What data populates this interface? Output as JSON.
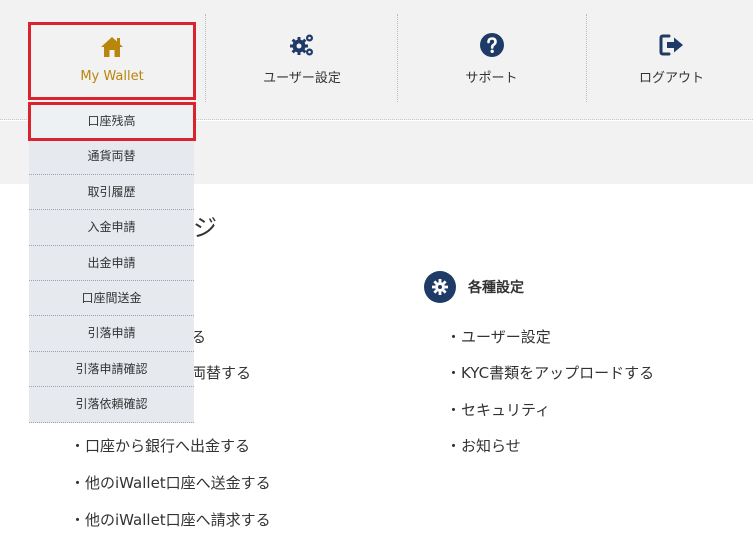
{
  "nav": {
    "items": [
      {
        "label": "My Wallet",
        "icon": "home-icon"
      },
      {
        "label": "ユーザー設定",
        "icon": "gears-icon"
      },
      {
        "label": "サポート",
        "icon": "question-circle-icon"
      },
      {
        "label": "ログアウト",
        "icon": "sign-out-icon"
      }
    ]
  },
  "dropdown": {
    "items": [
      "口座残高",
      "通貨両替",
      "取引履歴",
      "入金申請",
      "出金申請",
      "口座間送金",
      "引落申請",
      "引落申請確認",
      "引落依頼確認"
    ]
  },
  "page": {
    "title_fragment": "ジ"
  },
  "section_left": {
    "partial_links": [
      "する",
      "こ両替する"
    ],
    "links": [
      "・口座から銀行へ出金する",
      "・他のiWallet口座へ送金する",
      "・他のiWallet口座へ請求する"
    ]
  },
  "section_right": {
    "title": "各種設定",
    "icon": "gear-icon",
    "links": [
      "・ユーザー設定",
      "・KYC書類をアップロードする",
      "・セキュリティ",
      "・お知らせ"
    ]
  },
  "colors": {
    "accent_gold": "#b8860b",
    "navy": "#1e3a66",
    "highlight_red": "#d9232e",
    "nav_bg": "#f2f2f2",
    "dropdown_bg": "#e6eaef"
  }
}
